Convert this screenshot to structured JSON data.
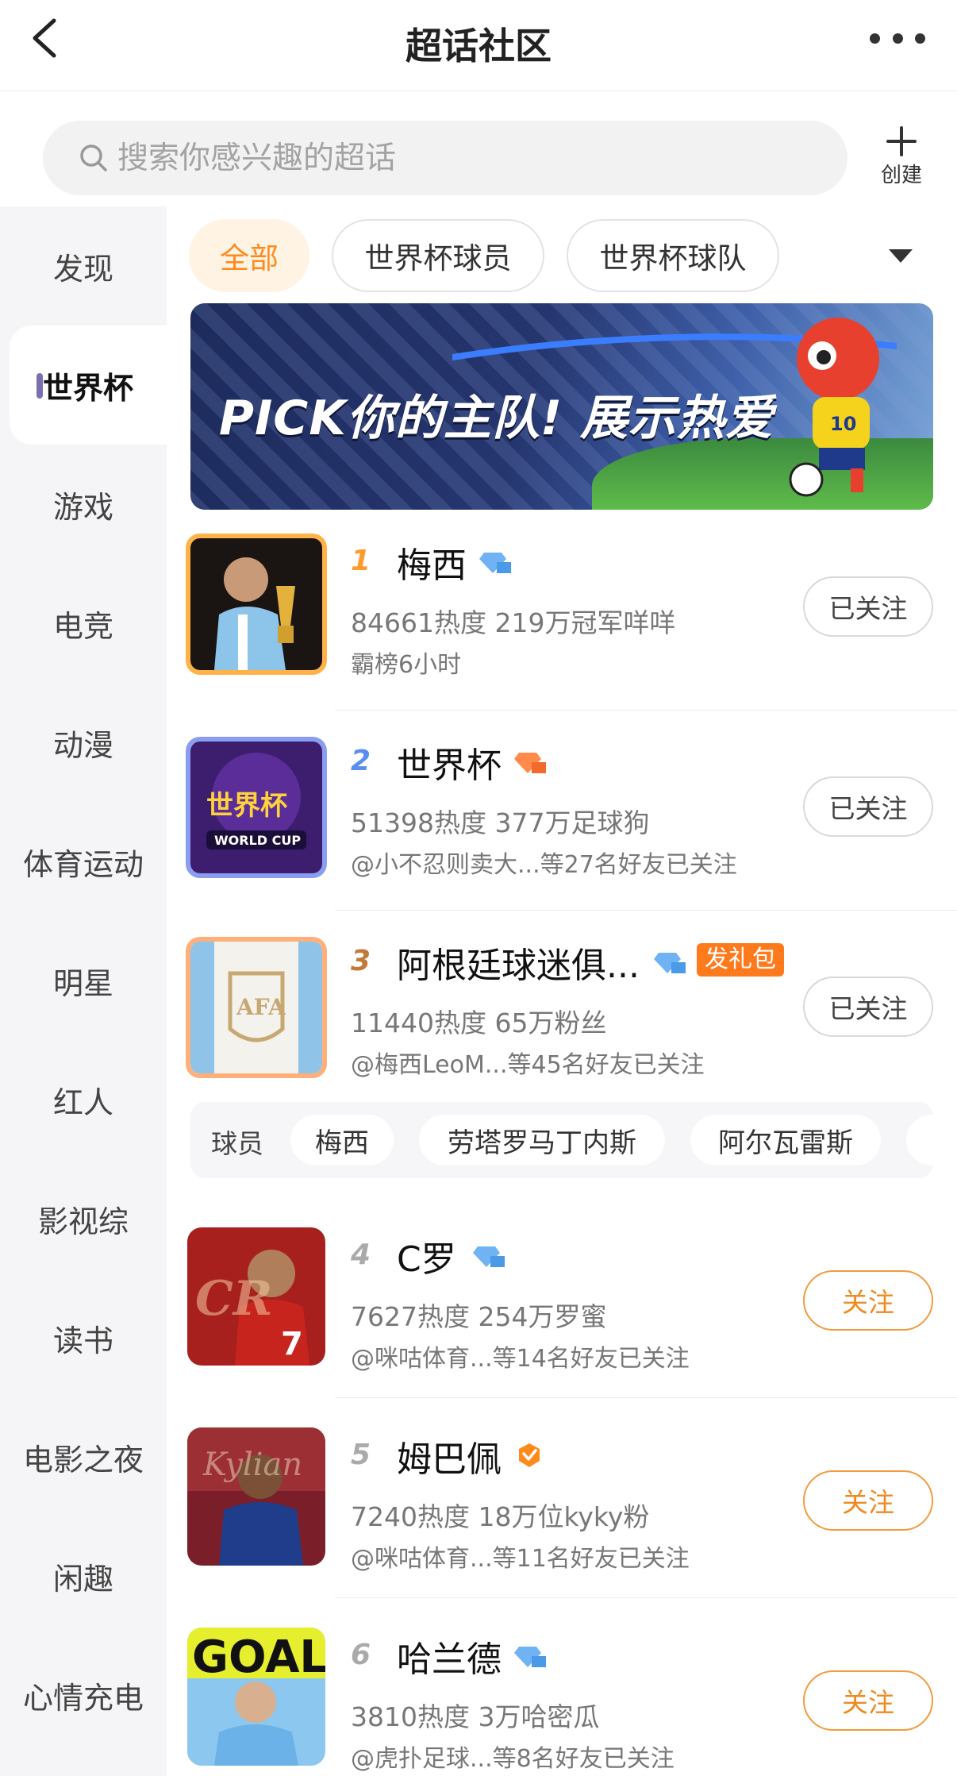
{
  "header": {
    "title": "超话社区"
  },
  "search": {
    "placeholder": "搜索你感兴趣的超话"
  },
  "create": {
    "label": "创建"
  },
  "sidebar": {
    "items": [
      {
        "label": "发现"
      },
      {
        "label": "世界杯",
        "active": true
      },
      {
        "label": "游戏"
      },
      {
        "label": "电竞"
      },
      {
        "label": "动漫"
      },
      {
        "label": "体育运动"
      },
      {
        "label": "明星"
      },
      {
        "label": "红人"
      },
      {
        "label": "影视综"
      },
      {
        "label": "读书"
      },
      {
        "label": "电影之夜"
      },
      {
        "label": "闲趣"
      },
      {
        "label": "心情充电"
      }
    ]
  },
  "chips": [
    {
      "label": "全部",
      "active": true
    },
    {
      "label": "世界杯球员"
    },
    {
      "label": "世界杯球队"
    }
  ],
  "banner": {
    "text": "PICK你的主队! 展示热爱"
  },
  "list": [
    {
      "rank": "1",
      "name": "梅西",
      "meta": "84661热度  219万冠军咩咩",
      "sub": "霸榜6小时",
      "button": "已关注",
      "badge": "blue-diamond-icon"
    },
    {
      "rank": "2",
      "name": "世界杯",
      "meta": "51398热度  377万足球狗",
      "sub": "@小不忍则卖大...等27名好友已关注",
      "button": "已关注",
      "badge": "orange-diamond-icon"
    },
    {
      "rank": "3",
      "name": "阿根廷球迷俱...",
      "gift": "发礼包",
      "meta": "11440热度  65万粉丝",
      "sub": "@梅西LeoM...等45名好友已关注",
      "button": "已关注",
      "badge": "blue-diamond-icon"
    },
    {
      "rank": "4",
      "name": "C罗",
      "meta": "7627热度  254万罗蜜",
      "sub": "@咪咕体育...等14名好友已关注",
      "button": "关注",
      "badge": "blue-diamond-icon"
    },
    {
      "rank": "5",
      "name": "姆巴佩",
      "meta": "7240热度  18万位kyky粉",
      "sub": "@咪咕体育...等11名好友已关注",
      "button": "关注",
      "badge": "orange-verified-icon"
    },
    {
      "rank": "6",
      "name": "哈兰德",
      "meta": "3810热度  3万哈密瓜",
      "sub": "@虎扑足球...等8名好友已关注",
      "button": "关注",
      "badge": "blue-diamond-icon"
    }
  ],
  "tagrow": {
    "label": "球员",
    "tags": [
      "梅西",
      "劳塔罗马丁内斯",
      "阿尔瓦雷斯"
    ]
  },
  "colors": {
    "accent": "#f08a22",
    "active_chip_bg": "#fff3e3",
    "sidebar_bg": "#f5f5f7"
  }
}
